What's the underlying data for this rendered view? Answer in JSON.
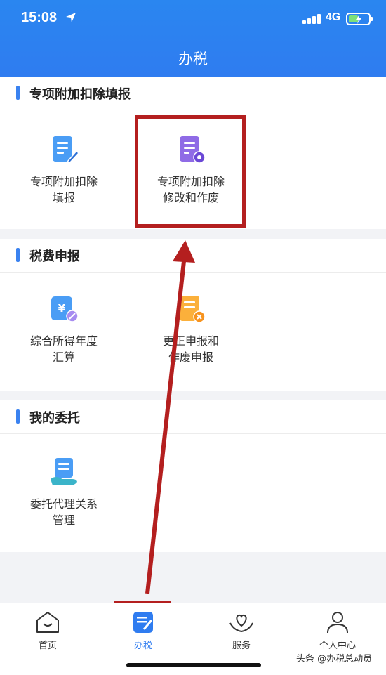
{
  "status_bar": {
    "time": "15:08",
    "network": "4G"
  },
  "nav": {
    "title": "办税"
  },
  "sections": [
    {
      "title": "专项附加扣除填报",
      "items": [
        {
          "line1": "专项附加扣除",
          "line2": "填报",
          "icon": "document-edit-icon"
        },
        {
          "line1": "专项附加扣除",
          "line2": "修改和作废",
          "icon": "document-settings-icon"
        }
      ]
    },
    {
      "title": "税费申报",
      "items": [
        {
          "line1": "综合所得年度",
          "line2": "汇算",
          "icon": "yuan-document-icon"
        },
        {
          "line1": "更正申报和",
          "line2": "作废申报",
          "icon": "document-cancel-icon"
        }
      ]
    },
    {
      "title": "我的委托",
      "items": [
        {
          "line1": "委托代理关系",
          "line2": "管理",
          "icon": "document-hand-icon"
        }
      ]
    }
  ],
  "tabbar": {
    "tabs": [
      {
        "label": "首页",
        "icon": "home-icon"
      },
      {
        "label": "办税",
        "icon": "tax-document-icon"
      },
      {
        "label": "服务",
        "icon": "service-heart-icon"
      },
      {
        "label": "个人中心",
        "icon": "person-icon"
      }
    ]
  },
  "watermark": "头条 @办税总动员",
  "colors": {
    "primary": "#2f7cf0",
    "annotation": "#b41f1f"
  }
}
